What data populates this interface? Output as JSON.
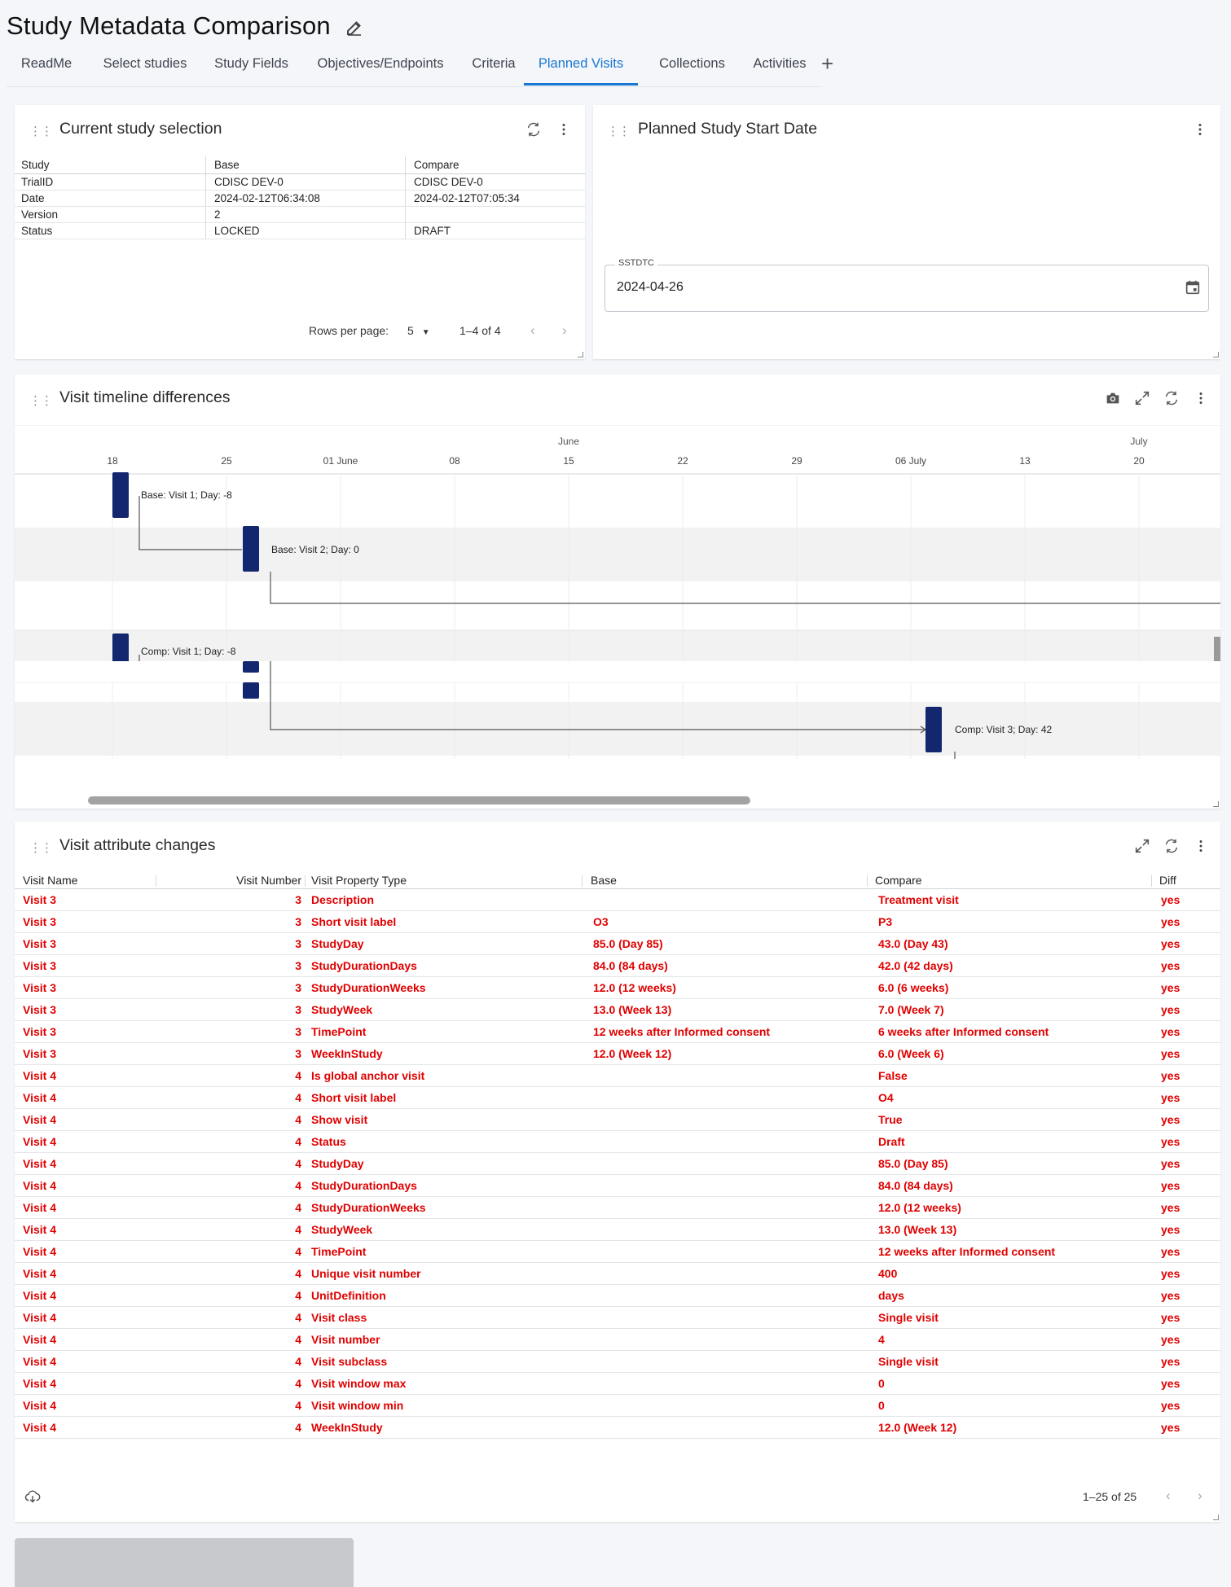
{
  "page": {
    "title": "Study Metadata Comparison"
  },
  "tabs": [
    {
      "label": "ReadMe",
      "active": false
    },
    {
      "label": "Select studies",
      "active": false
    },
    {
      "label": "Study Fields",
      "active": false
    },
    {
      "label": "Objectives/Endpoints",
      "active": false
    },
    {
      "label": "Criteria",
      "active": false
    },
    {
      "label": "Planned Visits",
      "active": true
    },
    {
      "label": "Collections",
      "active": false
    },
    {
      "label": "Activities",
      "active": false
    }
  ],
  "tab_add_label": "+",
  "selection": {
    "title": "Current study selection",
    "headers": [
      "Study",
      "Base",
      "Compare"
    ],
    "rows": [
      [
        "TrialID",
        "CDISC DEV-0",
        "CDISC DEV-0"
      ],
      [
        "Date",
        "2024-02-12T06:34:08",
        "2024-02-12T07:05:34"
      ],
      [
        "Version",
        "2",
        ""
      ],
      [
        "Status",
        "LOCKED",
        "DRAFT"
      ]
    ],
    "rows_per_page_label": "Rows per page:",
    "rows_per_page_value": "5",
    "range": "1–4 of 4"
  },
  "start_date": {
    "title": "Planned Study Start Date",
    "field_label": "SSTDTC",
    "value": "2024-04-26"
  },
  "timeline": {
    "title": "Visit timeline differences",
    "months": [
      "June",
      "July"
    ],
    "ticks": [
      "18",
      "25",
      "01 June",
      "08",
      "15",
      "22",
      "29",
      "06 July",
      "13",
      "20"
    ],
    "visit_labels": [
      "Base: Visit 1; Day: -8",
      "Base: Visit 2; Day: 0",
      "Comp: Visit 1; Day: -8",
      "Comp: Visit 3; Day: 42"
    ]
  },
  "attributes": {
    "title": "Visit attribute changes",
    "headers": [
      "Visit Name",
      "Visit Number",
      "Visit Property Type",
      "Base",
      "Compare",
      "Diff"
    ],
    "rows": [
      [
        "Visit 3",
        "3",
        "Description",
        "",
        "Treatment visit",
        "yes"
      ],
      [
        "Visit 3",
        "3",
        "Short visit label",
        "O3",
        "P3",
        "yes"
      ],
      [
        "Visit 3",
        "3",
        "StudyDay",
        "85.0 (Day 85)",
        "43.0 (Day 43)",
        "yes"
      ],
      [
        "Visit 3",
        "3",
        "StudyDurationDays",
        "84.0 (84 days)",
        "42.0 (42 days)",
        "yes"
      ],
      [
        "Visit 3",
        "3",
        "StudyDurationWeeks",
        "12.0 (12 weeks)",
        "6.0 (6 weeks)",
        "yes"
      ],
      [
        "Visit 3",
        "3",
        "StudyWeek",
        "13.0 (Week 13)",
        "7.0 (Week 7)",
        "yes"
      ],
      [
        "Visit 3",
        "3",
        "TimePoint",
        "12 weeks after Informed consent",
        "6 weeks after Informed consent",
        "yes"
      ],
      [
        "Visit 3",
        "3",
        "WeekInStudy",
        "12.0 (Week 12)",
        "6.0 (Week 6)",
        "yes"
      ],
      [
        "Visit 4",
        "4",
        "Is global anchor visit",
        "",
        "False",
        "yes"
      ],
      [
        "Visit 4",
        "4",
        "Short visit label",
        "",
        "O4",
        "yes"
      ],
      [
        "Visit 4",
        "4",
        "Show visit",
        "",
        "True",
        "yes"
      ],
      [
        "Visit 4",
        "4",
        "Status",
        "",
        "Draft",
        "yes"
      ],
      [
        "Visit 4",
        "4",
        "StudyDay",
        "",
        "85.0 (Day 85)",
        "yes"
      ],
      [
        "Visit 4",
        "4",
        "StudyDurationDays",
        "",
        "84.0 (84 days)",
        "yes"
      ],
      [
        "Visit 4",
        "4",
        "StudyDurationWeeks",
        "",
        "12.0 (12 weeks)",
        "yes"
      ],
      [
        "Visit 4",
        "4",
        "StudyWeek",
        "",
        "13.0 (Week 13)",
        "yes"
      ],
      [
        "Visit 4",
        "4",
        "TimePoint",
        "",
        "12 weeks after Informed consent",
        "yes"
      ],
      [
        "Visit 4",
        "4",
        "Unique visit number",
        "",
        "400",
        "yes"
      ],
      [
        "Visit 4",
        "4",
        "UnitDefinition",
        "",
        "days",
        "yes"
      ],
      [
        "Visit 4",
        "4",
        "Visit class",
        "",
        "Single visit",
        "yes"
      ],
      [
        "Visit 4",
        "4",
        "Visit number",
        "",
        "4",
        "yes"
      ],
      [
        "Visit 4",
        "4",
        "Visit subclass",
        "",
        "Single visit",
        "yes"
      ],
      [
        "Visit 4",
        "4",
        "Visit window max",
        "",
        "0",
        "yes"
      ],
      [
        "Visit 4",
        "4",
        "Visit window min",
        "",
        "0",
        "yes"
      ],
      [
        "Visit 4",
        "4",
        "WeekInStudy",
        "",
        "12.0 (Week 12)",
        "yes"
      ]
    ],
    "range": "1–25 of 25"
  },
  "colors": {
    "accent": "#1877d2",
    "diff_text": "#e00000",
    "visit_bar": "#13276e"
  },
  "icons": [
    "edit-icon",
    "drag-handle-icon",
    "refresh-icon",
    "more-vert-icon",
    "calendar-icon",
    "camera-icon",
    "fullscreen-icon",
    "download-icon",
    "chevron-left-icon",
    "chevron-right-icon"
  ]
}
